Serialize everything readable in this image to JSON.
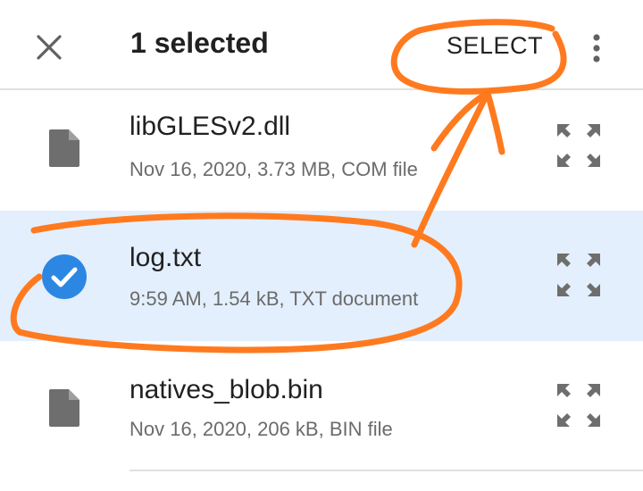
{
  "appbar": {
    "close_icon": "close-icon",
    "title": "1 selected",
    "select_label": "SELECT",
    "more_icon": "more-vert-icon"
  },
  "files": [
    {
      "name": "libGLESv2.dll",
      "meta": "Nov 16, 2020, 3.73 MB, COM file",
      "selected": false,
      "icon": "file-icon"
    },
    {
      "name": "log.txt",
      "meta": "9:59 AM, 1.54 kB, TXT document",
      "selected": true,
      "icon": "check-circle-icon"
    },
    {
      "name": "natives_blob.bin",
      "meta": "Nov 16, 2020, 206 kB, BIN file",
      "selected": false,
      "icon": "file-icon"
    }
  ],
  "colors": {
    "selected_row_bg": "#e3effc",
    "check_blue": "#2c87e3",
    "annotation_orange": "#ff7a1f",
    "icon_gray": "#6e6e6e"
  }
}
